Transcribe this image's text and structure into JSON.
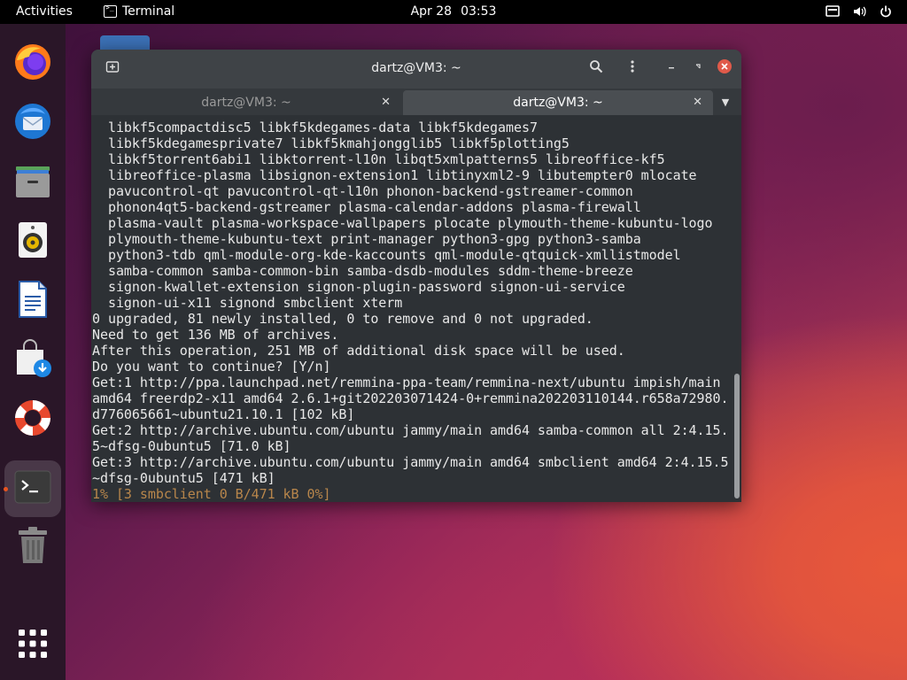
{
  "topbar": {
    "activities": "Activities",
    "app_name": "Terminal",
    "date": "Apr 28",
    "time": "03:53"
  },
  "dock": {
    "items": [
      {
        "name": "Firefox",
        "icon": "firefox-icon"
      },
      {
        "name": "Thunderbird",
        "icon": "thunderbird-icon"
      },
      {
        "name": "Files",
        "icon": "files-icon"
      },
      {
        "name": "Rhythmbox",
        "icon": "rhythmbox-icon"
      },
      {
        "name": "LibreOffice Writer",
        "icon": "writer-icon"
      },
      {
        "name": "Software",
        "icon": "software-icon"
      },
      {
        "name": "Help",
        "icon": "help-icon"
      },
      {
        "name": "Terminal",
        "icon": "terminal-icon",
        "active": true
      },
      {
        "name": "Trash",
        "icon": "trash-icon"
      },
      {
        "name": "Show Applications",
        "icon": "app-grid-icon"
      }
    ]
  },
  "window": {
    "title": "dartz@VM3: ~",
    "tabs": [
      {
        "label": "dartz@VM3: ~",
        "active": false
      },
      {
        "label": "dartz@VM3: ~",
        "active": true
      }
    ]
  },
  "terminal": {
    "lines": [
      "  libkf5compactdisc5 libkf5kdegames-data libkf5kdegames7",
      "  libkf5kdegamesprivate7 libkf5kmahjongglib5 libkf5plotting5",
      "  libkf5torrent6abi1 libktorrent-l10n libqt5xmlpatterns5 libreoffice-kf5",
      "  libreoffice-plasma libsignon-extension1 libtinyxml2-9 libutempter0 mlocate",
      "  pavucontrol-qt pavucontrol-qt-l10n phonon-backend-gstreamer-common",
      "  phonon4qt5-backend-gstreamer plasma-calendar-addons plasma-firewall",
      "  plasma-vault plasma-workspace-wallpapers plocate plymouth-theme-kubuntu-logo",
      "  plymouth-theme-kubuntu-text print-manager python3-gpg python3-samba",
      "  python3-tdb qml-module-org-kde-kaccounts qml-module-qtquick-xmllistmodel",
      "  samba-common samba-common-bin samba-dsdb-modules sddm-theme-breeze",
      "  signon-kwallet-extension signon-plugin-password signon-ui-service",
      "  signon-ui-x11 signond smbclient xterm",
      "0 upgraded, 81 newly installed, 0 to remove and 0 not upgraded.",
      "Need to get 136 MB of archives.",
      "After this operation, 251 MB of additional disk space will be used.",
      "Do you want to continue? [Y/n]",
      "Get:1 http://ppa.launchpad.net/remmina-ppa-team/remmina-next/ubuntu impish/main",
      "amd64 freerdp2-x11 amd64 2.6.1+git202203071424-0+remmina202203110144.r658a72980.",
      "d776065661~ubuntu21.10.1 [102 kB]",
      "Get:2 http://archive.ubuntu.com/ubuntu jammy/main amd64 samba-common all 2:4.15.",
      "5~dfsg-0ubuntu5 [71.0 kB]",
      "Get:3 http://archive.ubuntu.com/ubuntu jammy/main amd64 smbclient amd64 2:4.15.5",
      "~dfsg-0ubuntu5 [471 kB]"
    ],
    "status_line": "1% [3 smbclient 0 B/471 kB 0%]"
  },
  "colors": {
    "topbar_bg": "#000000",
    "dock_bg": "#2a1628",
    "terminal_bg": "#2d3135",
    "status_text": "#b8864b",
    "close_button": "#e05a4a",
    "run_indicator": "#e95420"
  }
}
